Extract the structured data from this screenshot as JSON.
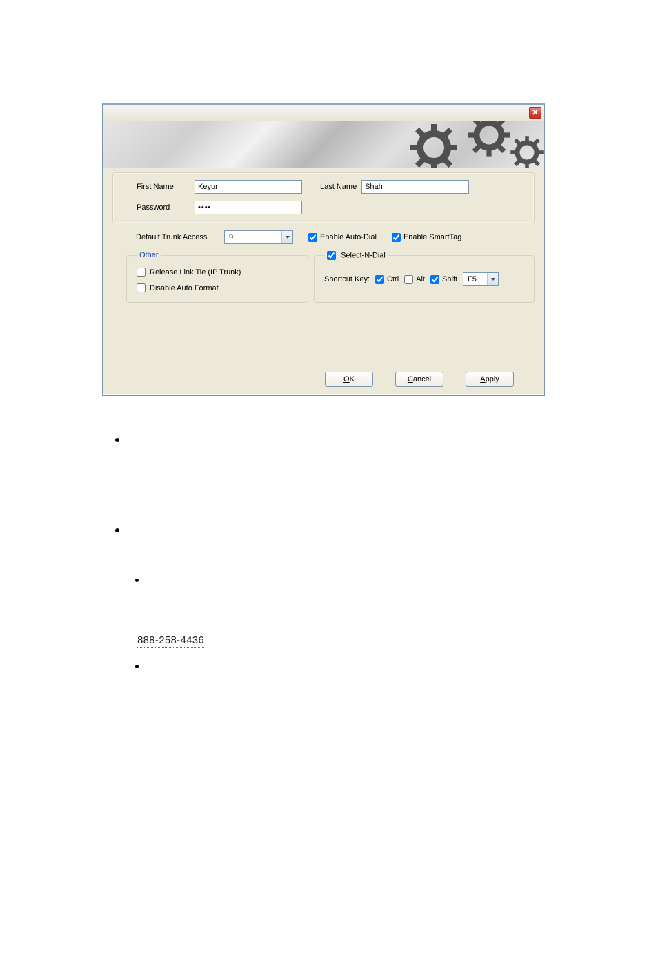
{
  "dialog": {
    "first_name_label": "First Name",
    "first_name_value": "Keyur",
    "last_name_label": "Last Name",
    "last_name_value": "Shah",
    "password_label": "Password",
    "password_value": "••••",
    "trunk_access_label": "Default Trunk Access",
    "trunk_access_value": "9",
    "enable_autodial_label": "Enable Auto-Dial",
    "enable_autodial_checked": true,
    "enable_smarttag_label": "Enable SmartTag",
    "enable_smarttag_checked": true,
    "other_legend": "Other",
    "release_link_label": "Release Link Tie (IP Trunk)",
    "release_link_checked": false,
    "disable_autoformat_label": "Disable Auto Format",
    "disable_autoformat_checked": false,
    "snd_legend": "Select-N-Dial",
    "snd_checked": true,
    "shortcut_key_label": "Shortcut Key:",
    "ctrl_label": "Ctrl",
    "ctrl_checked": true,
    "alt_label": "Alt",
    "alt_checked": false,
    "shift_label": "Shift",
    "shift_checked": true,
    "fkey_value": "F5",
    "buttons": {
      "ok_prefix": "O",
      "ok_suffix": "K",
      "cancel_prefix": "C",
      "cancel_suffix": "ancel",
      "apply_prefix": "A",
      "apply_suffix": "pply"
    }
  },
  "link_text": "888-258-4436"
}
